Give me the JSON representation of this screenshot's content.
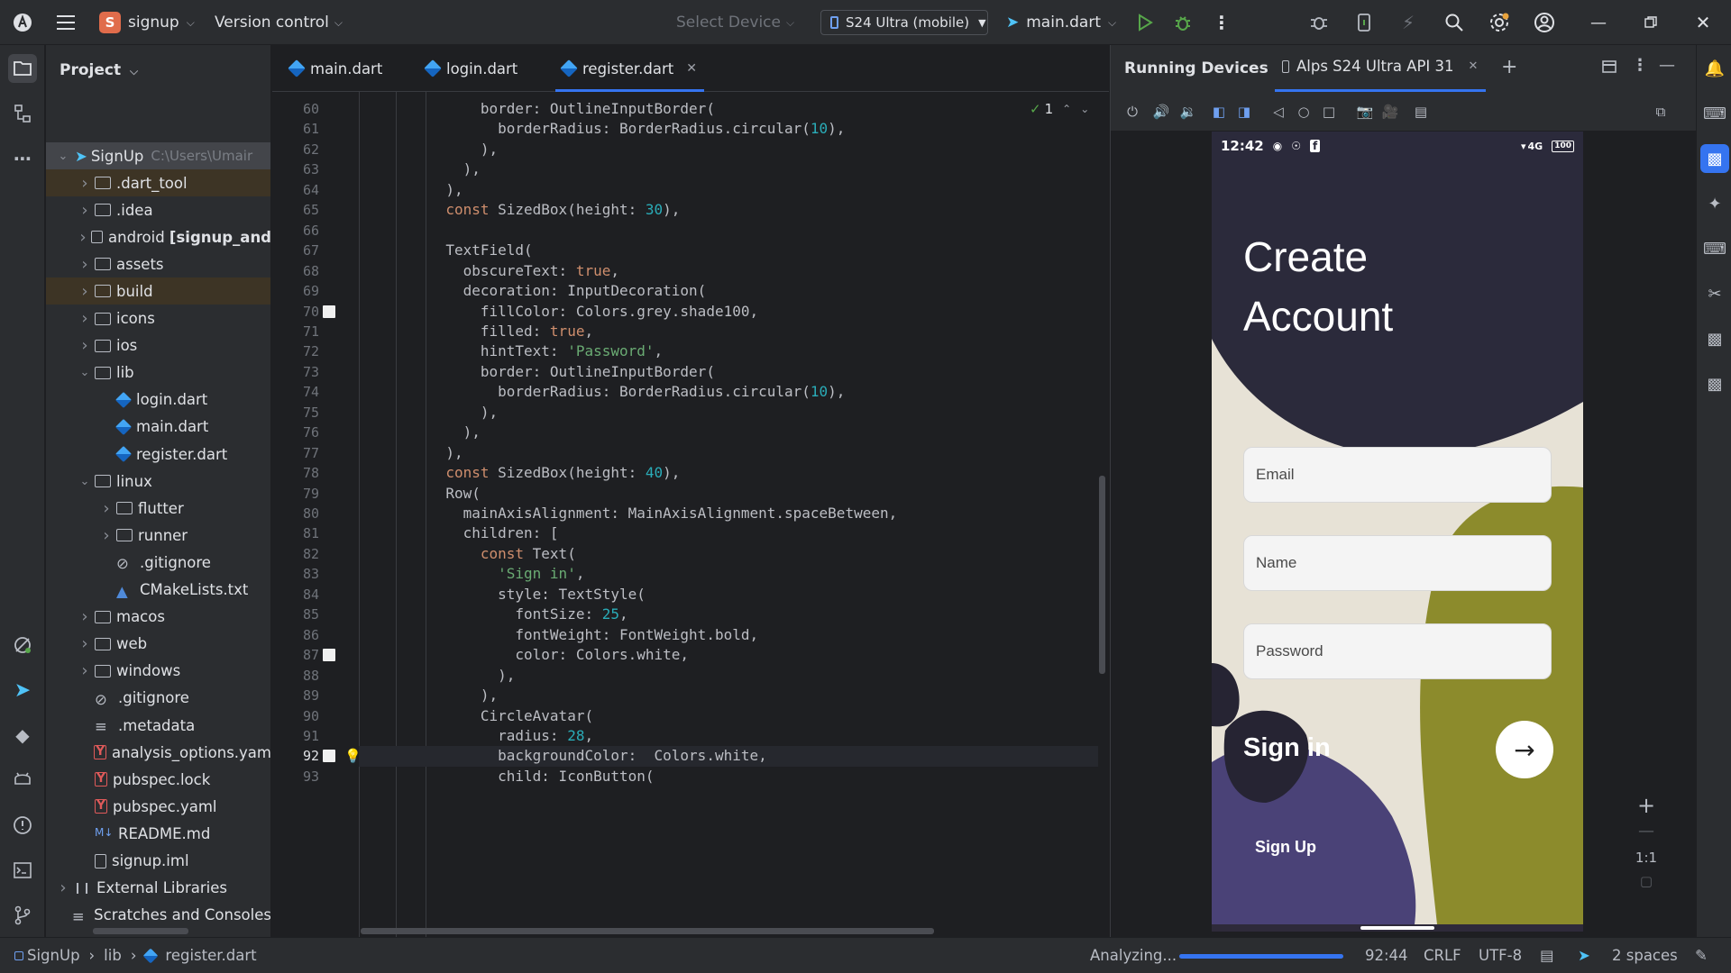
{
  "titlebar": {
    "project_initial": "S",
    "project_name": "signup",
    "vcs_label": "Version control",
    "select_device": "Select Device",
    "device": "S24 Ultra (mobile)",
    "run_config": "main.dart"
  },
  "project_panel": {
    "title": "Project",
    "root_name": "SignUp",
    "root_path": "C:\\Users\\Umair",
    "items": [
      {
        "label": ".dart_tool",
        "kind": "folder",
        "level": 1,
        "expanded": false,
        "highlight": true
      },
      {
        "label": ".idea",
        "kind": "folder",
        "level": 1,
        "expanded": false
      },
      {
        "label": "android [signup_and",
        "kind": "folder",
        "level": 1,
        "expanded": false
      },
      {
        "label": "assets",
        "kind": "folder",
        "level": 1,
        "expanded": false
      },
      {
        "label": "build",
        "kind": "folder",
        "level": 1,
        "expanded": false,
        "highlight": true
      },
      {
        "label": "icons",
        "kind": "folder",
        "level": 1,
        "expanded": false
      },
      {
        "label": "ios",
        "kind": "folder",
        "level": 1,
        "expanded": false
      },
      {
        "label": "lib",
        "kind": "folder",
        "level": 1,
        "expanded": true
      },
      {
        "label": "login.dart",
        "kind": "dart",
        "level": 2
      },
      {
        "label": "main.dart",
        "kind": "dart",
        "level": 2
      },
      {
        "label": "register.dart",
        "kind": "dart",
        "level": 2
      },
      {
        "label": "linux",
        "kind": "folder",
        "level": 1,
        "expanded": true
      },
      {
        "label": "flutter",
        "kind": "folder",
        "level": 2,
        "expanded": false
      },
      {
        "label": "runner",
        "kind": "folder",
        "level": 2,
        "expanded": false
      },
      {
        "label": ".gitignore",
        "kind": "ignore",
        "level": 2
      },
      {
        "label": "CMakeLists.txt",
        "kind": "cmake",
        "level": 2
      },
      {
        "label": "macos",
        "kind": "folder",
        "level": 1,
        "expanded": false
      },
      {
        "label": "web",
        "kind": "folder",
        "level": 1,
        "expanded": false
      },
      {
        "label": "windows",
        "kind": "folder",
        "level": 1,
        "expanded": false
      },
      {
        "label": ".gitignore",
        "kind": "ignore",
        "level": 1
      },
      {
        "label": ".metadata",
        "kind": "text",
        "level": 1
      },
      {
        "label": "analysis_options.yam",
        "kind": "yaml",
        "level": 1
      },
      {
        "label": "pubspec.lock",
        "kind": "yaml",
        "level": 1
      },
      {
        "label": "pubspec.yaml",
        "kind": "yaml",
        "level": 1
      },
      {
        "label": "README.md",
        "kind": "md",
        "level": 1
      },
      {
        "label": "signup.iml",
        "kind": "file",
        "level": 1
      },
      {
        "label": "External Libraries",
        "kind": "lib",
        "level": 0,
        "expanded": false
      },
      {
        "label": "Scratches and Consoles",
        "kind": "scratch",
        "level": 0
      }
    ]
  },
  "editor": {
    "tabs": [
      {
        "label": "main.dart",
        "active": false
      },
      {
        "label": "login.dart",
        "active": false
      },
      {
        "label": "register.dart",
        "active": true
      }
    ],
    "inspection_count": "1",
    "lines": [
      {
        "n": "60",
        "code": [
          [
            "",
            "              border: OutlineInputBorder("
          ]
        ]
      },
      {
        "n": "61",
        "code": [
          [
            "",
            "                borderRadius: BorderRadius.circular("
          ],
          [
            "num",
            "10"
          ],
          [
            "",
            "),"
          ]
        ]
      },
      {
        "n": "62",
        "code": [
          [
            "",
            "              ),"
          ]
        ]
      },
      {
        "n": "63",
        "code": [
          [
            "",
            "            ),"
          ]
        ]
      },
      {
        "n": "64",
        "code": [
          [
            "",
            "          ),"
          ]
        ]
      },
      {
        "n": "65",
        "code": [
          [
            "kw",
            "          const "
          ],
          [
            "",
            "SizedBox(height: "
          ],
          [
            "num",
            "30"
          ],
          [
            "",
            "),"
          ]
        ]
      },
      {
        "n": "66",
        "code": [
          [
            "",
            ""
          ]
        ]
      },
      {
        "n": "67",
        "code": [
          [
            "",
            "          TextField("
          ]
        ]
      },
      {
        "n": "68",
        "code": [
          [
            "",
            "            obscureText: "
          ],
          [
            "kw",
            "true"
          ],
          [
            "",
            ","
          ]
        ]
      },
      {
        "n": "69",
        "code": [
          [
            "",
            "            decoration: InputDecoration("
          ]
        ]
      },
      {
        "n": "70",
        "code": [
          [
            "",
            "              fillColor: Colors.grey.shade100,"
          ]
        ],
        "bookmark": true
      },
      {
        "n": "71",
        "code": [
          [
            "",
            "              filled: "
          ],
          [
            "kw",
            "true"
          ],
          [
            "",
            ","
          ]
        ]
      },
      {
        "n": "72",
        "code": [
          [
            "",
            "              hintText: "
          ],
          [
            "str",
            "'Password'"
          ],
          [
            "",
            ","
          ]
        ]
      },
      {
        "n": "73",
        "code": [
          [
            "",
            "              border: OutlineInputBorder("
          ]
        ]
      },
      {
        "n": "74",
        "code": [
          [
            "",
            "                borderRadius: BorderRadius.circular("
          ],
          [
            "num",
            "10"
          ],
          [
            "",
            "),"
          ]
        ]
      },
      {
        "n": "75",
        "code": [
          [
            "",
            "              ),"
          ]
        ]
      },
      {
        "n": "76",
        "code": [
          [
            "",
            "            ),"
          ]
        ]
      },
      {
        "n": "77",
        "code": [
          [
            "",
            "          ),"
          ]
        ]
      },
      {
        "n": "78",
        "code": [
          [
            "kw",
            "          const "
          ],
          [
            "",
            "SizedBox(height: "
          ],
          [
            "num",
            "40"
          ],
          [
            "",
            "),"
          ]
        ]
      },
      {
        "n": "79",
        "code": [
          [
            "",
            "          Row("
          ]
        ]
      },
      {
        "n": "80",
        "code": [
          [
            "",
            "            mainAxisAlignment: MainAxisAlignment.spaceBetween,"
          ]
        ]
      },
      {
        "n": "81",
        "code": [
          [
            "",
            "            children: ["
          ]
        ]
      },
      {
        "n": "82",
        "code": [
          [
            "kw",
            "              const "
          ],
          [
            "",
            "Text("
          ]
        ]
      },
      {
        "n": "83",
        "code": [
          [
            "str",
            "                'Sign in'"
          ],
          [
            "",
            ","
          ]
        ]
      },
      {
        "n": "84",
        "code": [
          [
            "",
            "                style: TextStyle("
          ]
        ]
      },
      {
        "n": "85",
        "code": [
          [
            "",
            "                  fontSize: "
          ],
          [
            "num",
            "25"
          ],
          [
            "",
            ","
          ]
        ]
      },
      {
        "n": "86",
        "code": [
          [
            "",
            "                  fontWeight: FontWeight.bold,"
          ]
        ]
      },
      {
        "n": "87",
        "code": [
          [
            "",
            "                  color: Colors.white,"
          ]
        ],
        "bookmark": true
      },
      {
        "n": "88",
        "code": [
          [
            "",
            "                ),"
          ]
        ]
      },
      {
        "n": "89",
        "code": [
          [
            "",
            "              ),"
          ]
        ]
      },
      {
        "n": "90",
        "code": [
          [
            "",
            "              CircleAvatar("
          ]
        ]
      },
      {
        "n": "91",
        "code": [
          [
            "",
            "                radius: "
          ],
          [
            "num",
            "28"
          ],
          [
            "",
            ","
          ]
        ]
      },
      {
        "n": "92",
        "code": [
          [
            "",
            "                backgroundColor:  Colors.white,"
          ]
        ],
        "bookmark": true,
        "current": true,
        "bulb": true
      },
      {
        "n": "93",
        "code": [
          [
            "",
            "                child: IconButton("
          ]
        ]
      }
    ]
  },
  "devices": {
    "title": "Running Devices",
    "tab": "Alps S24 Ultra API 31",
    "phone": {
      "time": "12:42",
      "network": "4G",
      "battery": "100",
      "heading_line1": "Create",
      "heading_line2": "Account",
      "email_hint": "Email",
      "name_hint": "Name",
      "password_hint": "Password",
      "signin": "Sign in",
      "signup": "Sign Up"
    },
    "zoom_label": "1:1"
  },
  "statusbar": {
    "crumb_project": "SignUp",
    "crumb_dir": "lib",
    "crumb_file": "register.dart",
    "analyzing": "Analyzing...",
    "progress": 1.0,
    "position": "92:44",
    "line_sep": "CRLF",
    "encoding": "UTF-8",
    "indent": "2 spaces"
  },
  "colors": {
    "accent": "#3574f0",
    "keyword": "#cf8e6d",
    "string": "#6aab73",
    "number": "#2aacb8"
  }
}
